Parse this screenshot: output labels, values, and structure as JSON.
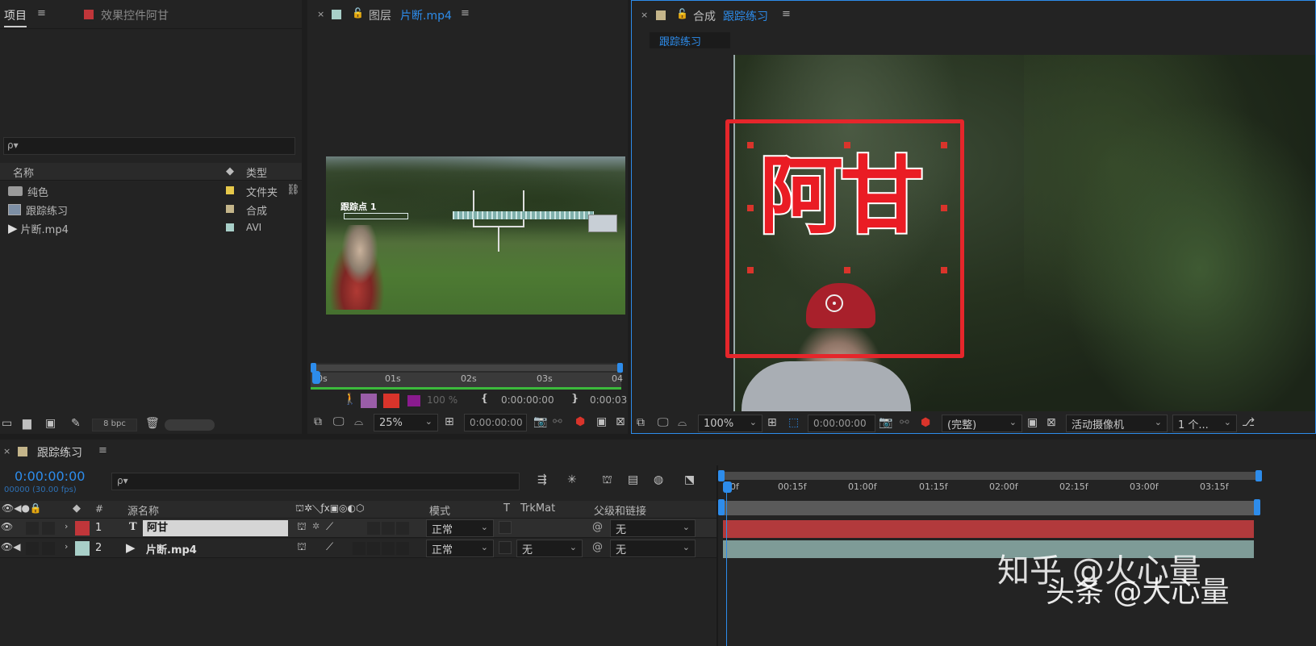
{
  "project_panel": {
    "tab_project": "项目",
    "tab_effects": "效果控件阿甘",
    "search_placeholder": "ρ▾",
    "col_name": "名称",
    "col_type": "类型",
    "items": [
      {
        "name": "纯色",
        "type": "文件夹",
        "color": "#e6c84a"
      },
      {
        "name": "跟踪练习",
        "type": "合成",
        "color": "#c4b58a"
      },
      {
        "name": "片断.mp4",
        "type": "AVI",
        "color": "#a8cfc8"
      }
    ],
    "bpc": "8 bpc"
  },
  "layer_panel": {
    "tab_prefix": "图层",
    "tab_name": "片断.mp4",
    "track_label": "跟踪点 1",
    "ruler": [
      "0s",
      "01s",
      "02s",
      "03s",
      "04"
    ],
    "zoom": "25%",
    "timecode": "0:00:00:00",
    "opacity": "100 %",
    "in_time": "0:00:00:00",
    "out_time": "0:00:03"
  },
  "comp_panel": {
    "tab_prefix": "合成",
    "tab_name": "跟踪练习",
    "breadcrumb": "跟踪练习",
    "text_layer": "阿甘",
    "zoom": "100%",
    "timecode": "0:00:00:00",
    "resolution": "(完整)",
    "camera": "活动摄像机",
    "views": "1 个..."
  },
  "timeline": {
    "tab_name": "跟踪练习",
    "timecode": "0:00:00:00",
    "frames": "00000 (30.00 fps)",
    "search_placeholder": "ρ▾",
    "col_source": "源名称",
    "col_mode": "模式",
    "col_t": "T",
    "col_trkmat": "TrkMat",
    "col_parent": "父级和链接",
    "col_num": "#",
    "ruler": [
      "0f",
      "00:15f",
      "01:00f",
      "01:15f",
      "02:00f",
      "02:15f",
      "03:00f",
      "03:15f"
    ],
    "layers": [
      {
        "num": "1",
        "name": "阿甘",
        "mode": "正常",
        "trkmat": "",
        "parent": "无",
        "color": "#c0363a"
      },
      {
        "num": "2",
        "name": "片断.mp4",
        "mode": "正常",
        "trkmat": "无",
        "parent": "无",
        "color": "#a8cfc8"
      }
    ]
  },
  "watermark": {
    "line1": "知乎 @火心量",
    "line2": "头条 @大心量"
  }
}
